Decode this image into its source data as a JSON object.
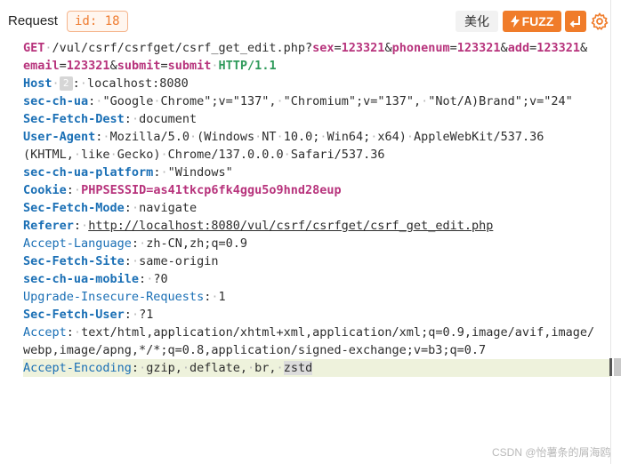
{
  "header": {
    "title": "Request",
    "id_label": "id: 18",
    "beautify_label": "美化",
    "fuzz_label": "FUZZ",
    "wrap_icon": "line-wrap-icon",
    "settings_icon": "gear-icon",
    "fuzz_icon": "lightning-icon"
  },
  "colors": {
    "accent": "#f07c2a",
    "header_key": "#1a6fb5",
    "method": "#b7337c",
    "param": "#b7337c",
    "version": "#2e9a5a"
  },
  "request": {
    "method": "GET",
    "path": "/vul/csrf/csrfget/csrf_get_edit.php?",
    "params": [
      {
        "name": "sex",
        "value": "123321"
      },
      {
        "name": "phonenum",
        "value": "123321"
      },
      {
        "name": "add",
        "value": "123321"
      },
      {
        "name": "email",
        "value": "123321"
      },
      {
        "name": "submit",
        "value": "submit"
      }
    ],
    "amp": "&",
    "eq": "=",
    "version": "HTTP/1.1",
    "headers": [
      {
        "key": "Host",
        "badge": "2",
        "value": "localhost:8080"
      },
      {
        "key": "sec-ch-ua",
        "value": "\"Google Chrome\";v=\"137\", \"Chromium\";v=\"137\", \"Not/A)Brand\";v=\"24\""
      },
      {
        "key": "Sec-Fetch-Dest",
        "value": "document"
      },
      {
        "key": "User-Agent",
        "value": "Mozilla/5.0 (Windows NT 10.0; Win64; x64) AppleWebKit/537.36",
        "value_cont": "(KHTML, like Gecko) Chrome/137.0.0.0 Safari/537.36"
      },
      {
        "key": "sec-ch-ua-platform",
        "value": "\"Windows\""
      },
      {
        "key": "Cookie",
        "value": "PHPSESSID=as41tkcp6fk4ggu5o9hnd28eup"
      },
      {
        "key": "Sec-Fetch-Mode",
        "value": "navigate"
      },
      {
        "key": "Referer",
        "value": "http://localhost:8080/vul/csrf/csrfget/csrf_get_edit.php"
      },
      {
        "key": "Accept-Language",
        "value": "zh-CN,zh;q=0.9"
      },
      {
        "key": "Sec-Fetch-Site",
        "value": "same-origin"
      },
      {
        "key": "sec-ch-ua-mobile",
        "value": "?0"
      },
      {
        "key": "Upgrade-Insecure-Requests",
        "value": "1"
      },
      {
        "key": "Sec-Fetch-User",
        "value": "?1"
      },
      {
        "key": "Accept",
        "value": "text/html,application/xhtml+xml,application/xml;q=0.9,image/avif,image/",
        "value_cont": "webp,image/apng,*/*;q=0.8,application/signed-exchange;v=b3;q=0.7"
      },
      {
        "key": "Accept-Encoding",
        "value": "gzip, deflate, br, ",
        "value_hl": "zstd"
      }
    ]
  },
  "watermark": "CSDN @怡薯条的屑海鸥"
}
